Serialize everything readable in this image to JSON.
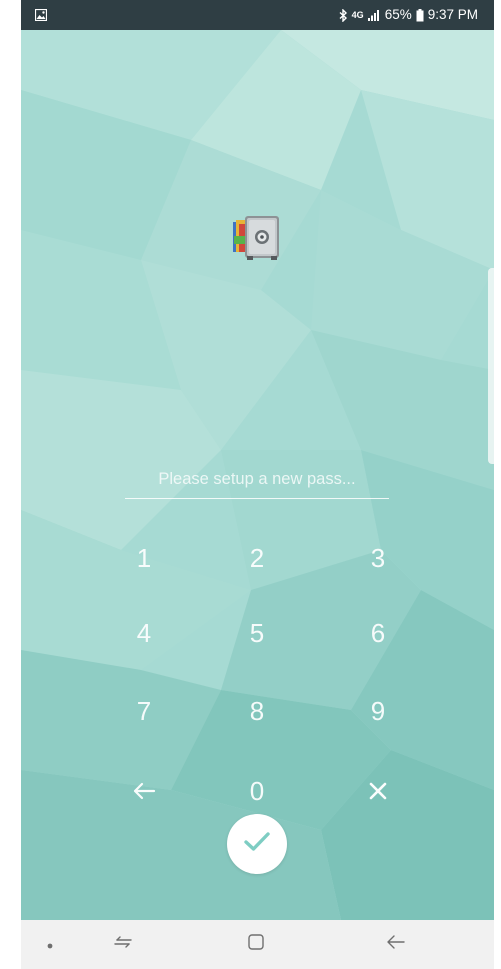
{
  "status_bar": {
    "gallery_icon": "image-notification-icon",
    "bluetooth_icon": "bluetooth-icon",
    "network": "4G",
    "battery_percent": "65%",
    "time": "9:37 PM"
  },
  "lock_screen": {
    "app_icon": "app-lock-safe-icon",
    "password_placeholder": "Please setup a new pass...",
    "keys": [
      "1",
      "2",
      "3",
      "4",
      "5",
      "6",
      "7",
      "8",
      "9",
      "0"
    ],
    "backspace_icon": "backspace-arrow-icon",
    "clear_icon": "clear-x-icon",
    "confirm_icon": "checkmark-icon"
  },
  "nav_bar": {
    "items": [
      "dot-icon",
      "recent-apps-icon",
      "home-icon",
      "back-icon"
    ]
  },
  "colors": {
    "background": "#a9dcd5",
    "status_bar": "#2f3e44",
    "accent_check": "#7ecdc3"
  }
}
